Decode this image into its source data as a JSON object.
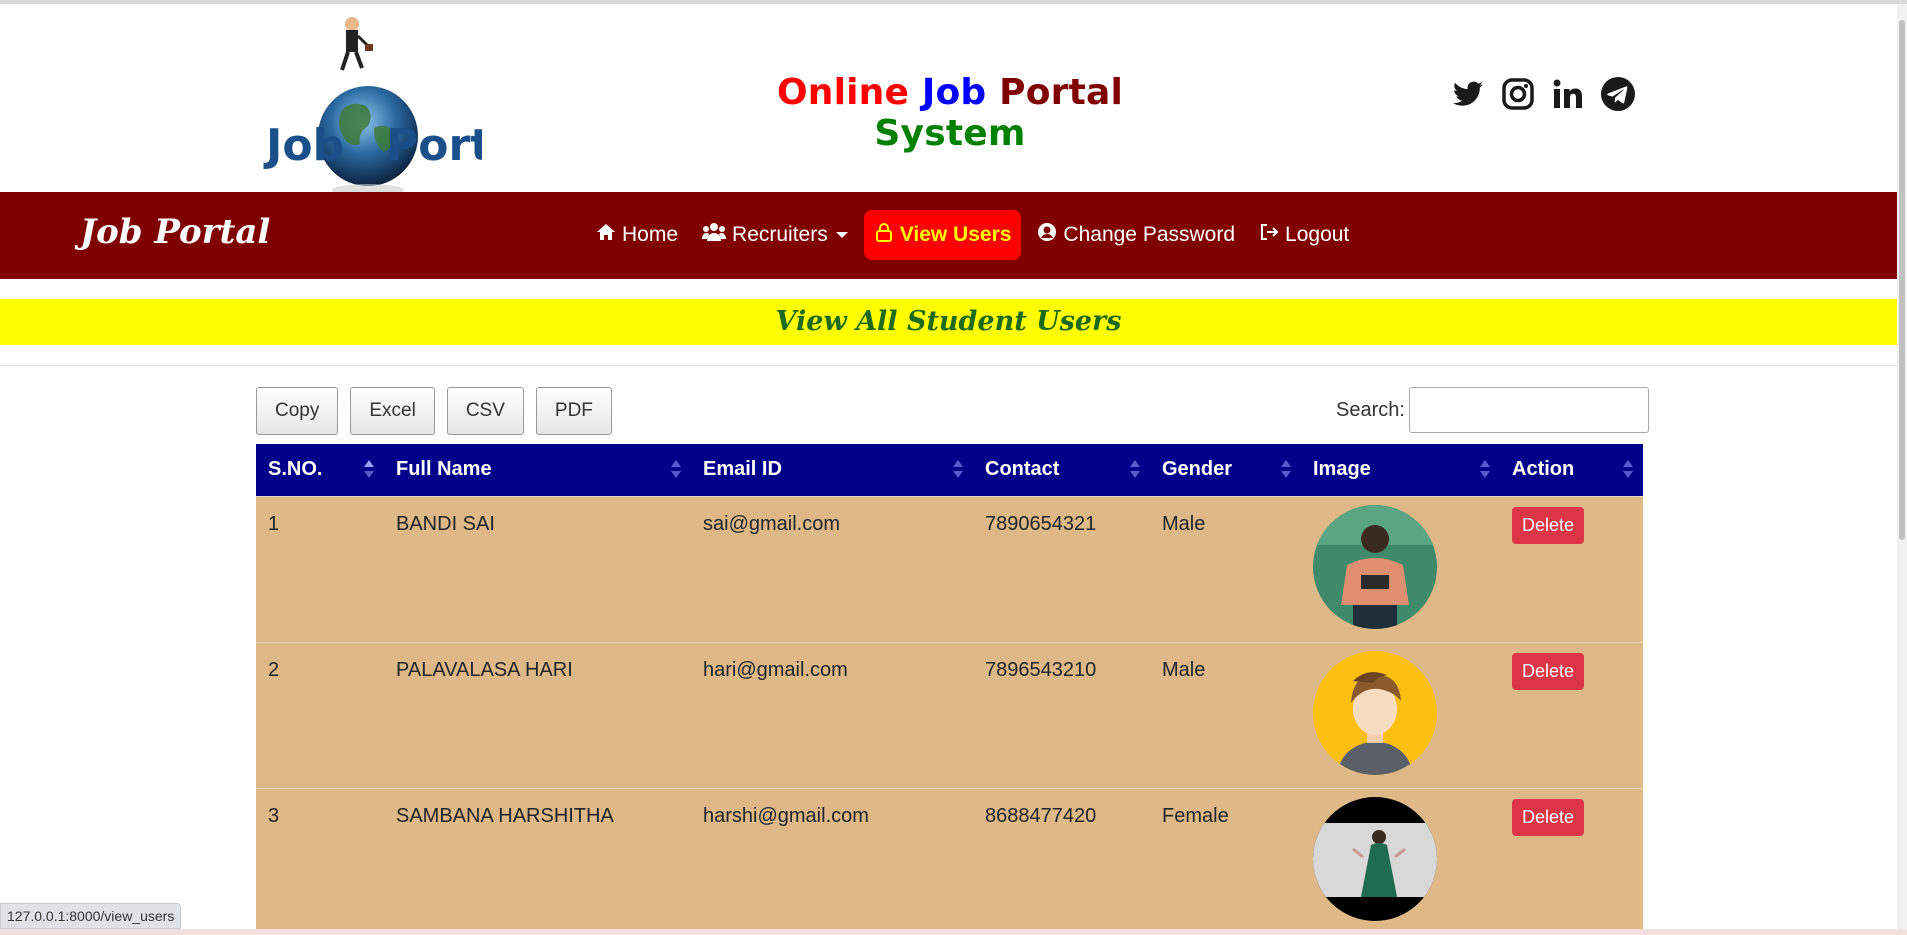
{
  "header": {
    "logo_text_left": "Job",
    "logo_text_right": "Portal",
    "title_parts": [
      {
        "text": "Online",
        "color": "#ff0000"
      },
      {
        "text": "Job",
        "color": "#0000ff"
      },
      {
        "text": "Portal",
        "color": "#800000"
      },
      {
        "text": "System",
        "color": "#008000"
      }
    ],
    "social_icons": [
      "twitter-icon",
      "instagram-icon",
      "linkedin-icon",
      "telegram-icon"
    ]
  },
  "navbar": {
    "brand": "Job Portal",
    "items": [
      {
        "label": "Home",
        "icon": "home-icon"
      },
      {
        "label": "Recruiters",
        "icon": "users-icon"
      },
      {
        "label": "View Users",
        "icon": "lock-icon",
        "active": true
      },
      {
        "label": "Change Password",
        "icon": "user-circle-icon"
      },
      {
        "label": "Logout",
        "icon": "logout-icon"
      }
    ]
  },
  "page_heading": "View All Student Users",
  "toolbar": {
    "buttons": [
      "Copy",
      "Excel",
      "CSV",
      "PDF"
    ],
    "search_label": "Search:",
    "search_value": ""
  },
  "table": {
    "columns": [
      "S.NO.",
      "Full Name",
      "Email ID",
      "Contact",
      "Gender",
      "Image",
      "Action"
    ],
    "rows": [
      {
        "sno": "1",
        "name": "BANDI SAI",
        "email": "sai@gmail.com",
        "contact": "7890654321",
        "gender": "Male",
        "action": "Delete"
      },
      {
        "sno": "2",
        "name": "PALAVALASA HARI",
        "email": "hari@gmail.com",
        "contact": "7896543210",
        "gender": "Male",
        "action": "Delete"
      },
      {
        "sno": "3",
        "name": "SAMBANA HARSHITHA",
        "email": "harshi@gmail.com",
        "contact": "8688477420",
        "gender": "Female",
        "action": "Delete"
      }
    ]
  },
  "status_bar": "127.0.0.1:8000/view_users",
  "colors": {
    "navbar_bg": "#800000",
    "active_nav_bg": "#ff0000",
    "active_nav_text": "#ffff00",
    "heading_bg": "#ffff00",
    "heading_text": "#1d6a1d",
    "table_head_bg": "#00008b",
    "row_bg": "#deb887",
    "delete_btn": "#dc3545"
  }
}
